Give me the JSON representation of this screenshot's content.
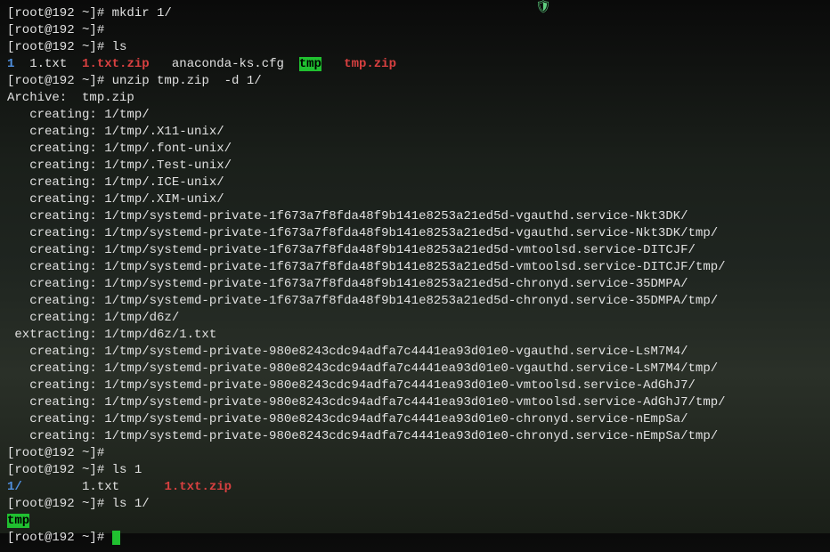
{
  "prompt": {
    "text": "[root@192 ~]# "
  },
  "commands": {
    "mkdir": "mkdir 1/",
    "ls": "ls",
    "unzip": "unzip tmp.zip  -d 1/",
    "ls1": "ls 1",
    "ls1slash": "ls 1/"
  },
  "ls_output": {
    "dir1": "1",
    "file1": "1.txt",
    "zip1": "1.txt.zip",
    "cfg": "anaconda-ks.cfg",
    "tmpdir": "tmp",
    "tmpzip": "tmp.zip"
  },
  "unzip_output": [
    "Archive:  tmp.zip",
    "   creating: 1/tmp/",
    "   creating: 1/tmp/.X11-unix/",
    "   creating: 1/tmp/.font-unix/",
    "   creating: 1/tmp/.Test-unix/",
    "   creating: 1/tmp/.ICE-unix/",
    "   creating: 1/tmp/.XIM-unix/",
    "   creating: 1/tmp/systemd-private-1f673a7f8fda48f9b141e8253a21ed5d-vgauthd.service-Nkt3DK/",
    "   creating: 1/tmp/systemd-private-1f673a7f8fda48f9b141e8253a21ed5d-vgauthd.service-Nkt3DK/tmp/",
    "   creating: 1/tmp/systemd-private-1f673a7f8fda48f9b141e8253a21ed5d-vmtoolsd.service-DITCJF/",
    "   creating: 1/tmp/systemd-private-1f673a7f8fda48f9b141e8253a21ed5d-vmtoolsd.service-DITCJF/tmp/",
    "   creating: 1/tmp/systemd-private-1f673a7f8fda48f9b141e8253a21ed5d-chronyd.service-35DMPA/",
    "   creating: 1/tmp/systemd-private-1f673a7f8fda48f9b141e8253a21ed5d-chronyd.service-35DMPA/tmp/",
    "   creating: 1/tmp/d6z/",
    " extracting: 1/tmp/d6z/1.txt",
    "   creating: 1/tmp/systemd-private-980e8243cdc94adfa7c4441ea93d01e0-vgauthd.service-LsM7M4/",
    "   creating: 1/tmp/systemd-private-980e8243cdc94adfa7c4441ea93d01e0-vgauthd.service-LsM7M4/tmp/",
    "   creating: 1/tmp/systemd-private-980e8243cdc94adfa7c4441ea93d01e0-vmtoolsd.service-AdGhJ7/",
    "   creating: 1/tmp/systemd-private-980e8243cdc94adfa7c4441ea93d01e0-vmtoolsd.service-AdGhJ7/tmp/",
    "   creating: 1/tmp/systemd-private-980e8243cdc94adfa7c4441ea93d01e0-chronyd.service-nEmpSa/",
    "   creating: 1/tmp/systemd-private-980e8243cdc94adfa7c4441ea93d01e0-chronyd.service-nEmpSa/tmp/"
  ],
  "ls1_output": {
    "dir": "1/",
    "file": "1.txt",
    "zip": "1.txt.zip"
  },
  "ls1slash_output": {
    "tmpdir": "tmp"
  },
  "final_prompt_partial": "[root@192 ~]# "
}
